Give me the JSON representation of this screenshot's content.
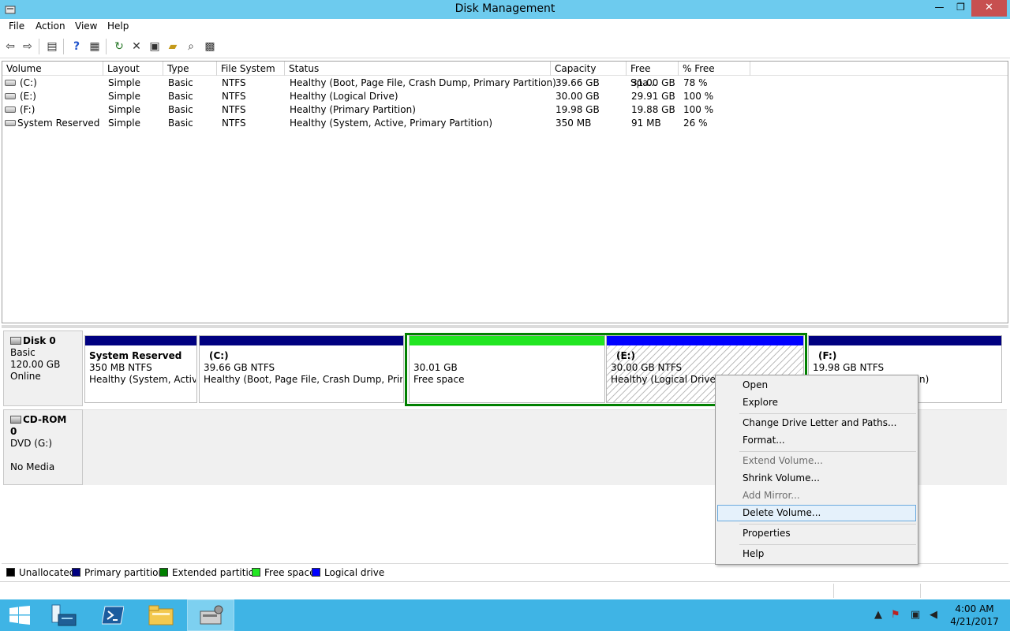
{
  "window": {
    "title": "Disk Management",
    "controls": {
      "minimize": "—",
      "maximize": "❐",
      "close": "✕"
    }
  },
  "menu": [
    "File",
    "Action",
    "View",
    "Help"
  ],
  "columns": [
    "Volume",
    "Layout",
    "Type",
    "File System",
    "Status",
    "Capacity",
    "Free Spa...",
    "% Free"
  ],
  "volumes": [
    {
      "volume": "(C:)",
      "layout": "Simple",
      "type": "Basic",
      "fs": "NTFS",
      "status": "Healthy (Boot, Page File, Crash Dump, Primary Partition)",
      "capacity": "39.66 GB",
      "free": "31.00 GB",
      "pct": "78 %"
    },
    {
      "volume": "(E:)",
      "layout": "Simple",
      "type": "Basic",
      "fs": "NTFS",
      "status": "Healthy (Logical Drive)",
      "capacity": "30.00 GB",
      "free": "29.91 GB",
      "pct": "100 %"
    },
    {
      "volume": "(F:)",
      "layout": "Simple",
      "type": "Basic",
      "fs": "NTFS",
      "status": "Healthy (Primary Partition)",
      "capacity": "19.98 GB",
      "free": "19.88 GB",
      "pct": "100 %"
    },
    {
      "volume": "System Reserved",
      "layout": "Simple",
      "type": "Basic",
      "fs": "NTFS",
      "status": "Healthy (System, Active, Primary Partition)",
      "capacity": "350 MB",
      "free": "91 MB",
      "pct": "26 %"
    }
  ],
  "disk0": {
    "name": "Disk 0",
    "type": "Basic",
    "size": "120.00 GB",
    "state": "Online",
    "partitions": [
      {
        "name": "System Reserved",
        "size": "350 MB NTFS",
        "status": "Healthy (System, Active,"
      },
      {
        "name": "(C:)",
        "size": "39.66 GB NTFS",
        "status": "Healthy (Boot, Page File, Crash Dump, Primary"
      },
      {
        "name": "",
        "size": "30.01 GB",
        "status": "Free space"
      },
      {
        "name": "(E:)",
        "size": "30.00 GB NTFS",
        "status": "Healthy (Logical Drive)"
      },
      {
        "name": "(F:)",
        "size": "19.98 GB NTFS",
        "status": "n)"
      }
    ]
  },
  "cdrom0": {
    "name": "CD-ROM 0",
    "type": "DVD (G:)",
    "media": "No Media"
  },
  "legend": [
    {
      "label": "Unallocated",
      "color": "#000000"
    },
    {
      "label": "Primary partition",
      "color": "#000080"
    },
    {
      "label": "Extended partition",
      "color": "#008000"
    },
    {
      "label": "Free space",
      "color": "#22e622"
    },
    {
      "label": "Logical drive",
      "color": "#0000ff"
    }
  ],
  "context_menu": [
    {
      "label": "Open",
      "enabled": true
    },
    {
      "label": "Explore",
      "enabled": true
    },
    {
      "label": "Change Drive Letter and Paths...",
      "enabled": true
    },
    {
      "label": "Format...",
      "enabled": true
    },
    {
      "label": "Extend Volume...",
      "enabled": false
    },
    {
      "label": "Shrink Volume...",
      "enabled": true
    },
    {
      "label": "Add Mirror...",
      "enabled": false
    },
    {
      "label": "Delete Volume...",
      "enabled": true,
      "selected": true
    },
    {
      "label": "Properties",
      "enabled": true
    },
    {
      "label": "Help",
      "enabled": true
    }
  ],
  "taskbar": {
    "time": "4:00 AM",
    "date": "4/21/2017",
    "apps": [
      "start-icon",
      "server-manager-icon",
      "powershell-icon",
      "file-explorer-icon",
      "disk-management-icon"
    ]
  },
  "colors": {
    "titlebar": "#6dcbee",
    "taskbar": "#3fb4e5",
    "primary": "#000080",
    "logical": "#0000ff",
    "free": "#22e622",
    "extended": "#008000"
  }
}
